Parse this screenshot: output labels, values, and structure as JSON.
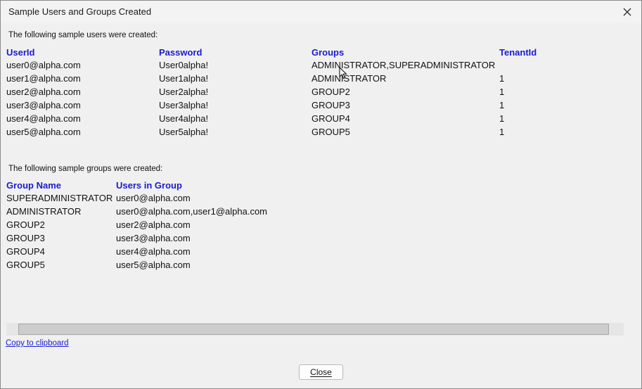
{
  "window": {
    "title": "Sample Users and Groups Created"
  },
  "users_section": {
    "caption": "The following sample users were created:",
    "headers": [
      "UserId",
      "Password",
      "Groups",
      "TenantId"
    ],
    "rows": [
      [
        "user0@alpha.com",
        "User0alpha!",
        "ADMINISTRATOR,SUPERADMINISTRATOR",
        ""
      ],
      [
        "user1@alpha.com",
        "User1alpha!",
        "ADMINISTRATOR",
        "1"
      ],
      [
        "user2@alpha.com",
        "User2alpha!",
        "GROUP2",
        "1"
      ],
      [
        "user3@alpha.com",
        "User3alpha!",
        "GROUP3",
        "1"
      ],
      [
        "user4@alpha.com",
        "User4alpha!",
        "GROUP4",
        "1"
      ],
      [
        "user5@alpha.com",
        "User5alpha!",
        "GROUP5",
        "1"
      ]
    ]
  },
  "groups_section": {
    "caption": "The following sample groups were created:",
    "headers": [
      "Group Name",
      "Users in Group"
    ],
    "rows": [
      [
        "SUPERADMINISTRATOR",
        "user0@alpha.com"
      ],
      [
        "ADMINISTRATOR",
        "user0@alpha.com,user1@alpha.com"
      ],
      [
        "GROUP2",
        "user2@alpha.com"
      ],
      [
        "GROUP3",
        "user3@alpha.com"
      ],
      [
        "GROUP4",
        "user4@alpha.com"
      ],
      [
        "GROUP5",
        "user5@alpha.com"
      ]
    ]
  },
  "footer": {
    "copy_link": "Copy to clipboard",
    "close_button": "Close"
  },
  "colors": {
    "header_blue": "#1a1ad0",
    "background": "#f0f0f0"
  },
  "icons": {
    "close": "close-icon",
    "cursor": "mouse-cursor-icon"
  }
}
